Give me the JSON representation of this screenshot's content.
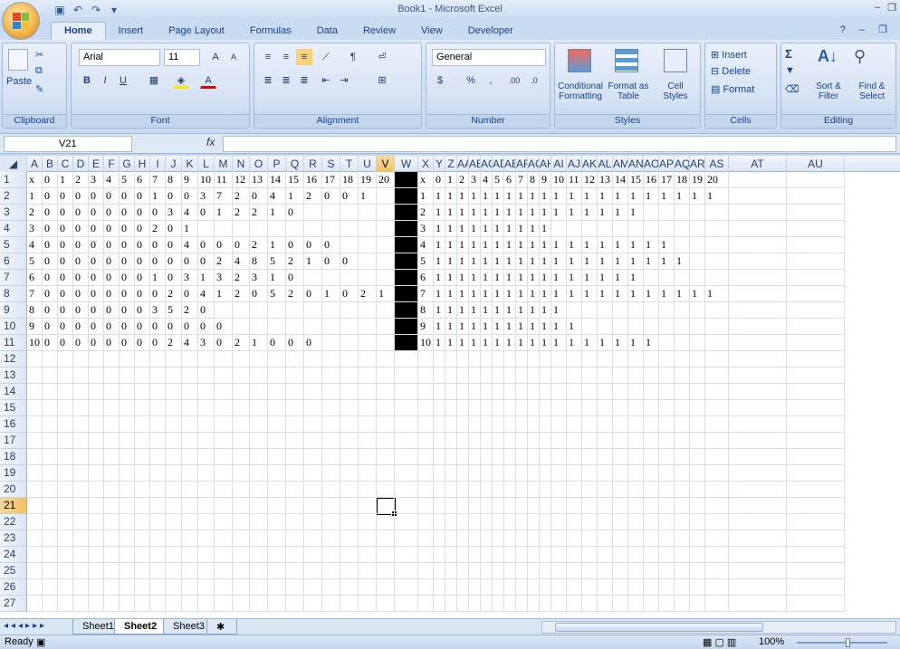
{
  "window": {
    "title": "Book1 - Microsoft Excel"
  },
  "tabs": [
    "Home",
    "Insert",
    "Page Layout",
    "Formulas",
    "Data",
    "Review",
    "View",
    "Developer"
  ],
  "ribbon": {
    "clipboard": {
      "paste": "Paste",
      "name": "Clipboard"
    },
    "font": {
      "family": "Arial",
      "size": "11",
      "name": "Font",
      "bold": "B",
      "italic": "I",
      "underline": "U"
    },
    "alignment": {
      "name": "Alignment"
    },
    "number": {
      "format": "General",
      "percent": "%",
      "comma": ",",
      "inc": ".00",
      "name": "Number"
    },
    "styles": {
      "cond": "Conditional Formatting",
      "table": "Format as Table",
      "cell": "Cell Styles",
      "name": "Styles"
    },
    "cells": {
      "insert": "Insert",
      "delete": "Delete",
      "format": "Format",
      "name": "Cells"
    },
    "editing": {
      "sigma": "Σ",
      "sort": "Sort & Filter",
      "find": "Find & Select",
      "name": "Editing"
    }
  },
  "formula_bar": {
    "name_box": "V21",
    "fx": "fx",
    "value": ""
  },
  "columns": [
    "A",
    "B",
    "C",
    "D",
    "E",
    "F",
    "G",
    "H",
    "I",
    "J",
    "K",
    "L",
    "M",
    "N",
    "O",
    "P",
    "Q",
    "R",
    "S",
    "T",
    "U",
    "V",
    "W",
    "X",
    "Y",
    "Z",
    "AA",
    "AB",
    "AC",
    "AD",
    "AE",
    "AF",
    "AG",
    "AH",
    "AI",
    "AJ",
    "AK",
    "AL",
    "AM",
    "AN",
    "AO",
    "AP",
    "AQ",
    "AR",
    "AS",
    "AT",
    "AU"
  ],
  "column_headers_shown": [
    "A",
    "B",
    "C",
    "D",
    "E",
    "F",
    "G",
    "H",
    "I",
    "J",
    "K",
    "L",
    "M",
    "N",
    "O",
    "P",
    "Q",
    "R",
    "S",
    "T",
    "U",
    "V",
    "W",
    "X",
    "Y",
    "Z",
    "AA",
    "AB",
    "AC",
    "AD",
    "AE",
    "AF",
    "AG",
    "AH",
    "AI",
    "AJ",
    "AK",
    "AL",
    "AM",
    "AN",
    "AO",
    "AP",
    "AQ",
    "AR",
    "AS",
    "AT",
    "AU"
  ],
  "rows": [
    [
      "x",
      "0",
      "1",
      "2",
      "3",
      "4",
      "5",
      "6",
      "7",
      "8",
      "9",
      "10",
      "11",
      "12",
      "13",
      "14",
      "15",
      "16",
      "17",
      "18",
      "19",
      "20",
      "",
      "x",
      "0",
      "1",
      "2",
      "3",
      "4",
      "5",
      "6",
      "7",
      "8",
      "9",
      "10",
      "11",
      "12",
      "13",
      "14",
      "15",
      "16",
      "17",
      "18",
      "19",
      "20"
    ],
    [
      "1",
      "0",
      "0",
      "0",
      "0",
      "0",
      "0",
      "0",
      "1",
      "0",
      "0",
      "3",
      "7",
      "2",
      "0",
      "4",
      "1",
      "2",
      "0",
      "0",
      "1",
      "",
      "",
      "1",
      "1",
      "1",
      "1",
      "1",
      "1",
      "1",
      "1",
      "1",
      "1",
      "1",
      "1",
      "1",
      "1",
      "1",
      "1",
      "1",
      "1",
      "1",
      "1",
      "1",
      "1"
    ],
    [
      "2",
      "0",
      "0",
      "0",
      "0",
      "0",
      "0",
      "0",
      "0",
      "3",
      "4",
      "0",
      "1",
      "2",
      "2",
      "1",
      "0",
      "",
      "",
      "",
      "",
      "",
      "",
      "2",
      "1",
      "1",
      "1",
      "1",
      "1",
      "1",
      "1",
      "1",
      "1",
      "1",
      "1",
      "1",
      "1",
      "1",
      "1",
      "1"
    ],
    [
      "3",
      "0",
      "0",
      "0",
      "0",
      "0",
      "0",
      "0",
      "2",
      "0",
      "1",
      "",
      "",
      "",
      "",
      "",
      "",
      "",
      "",
      "",
      "",
      "",
      "",
      "3",
      "1",
      "1",
      "1",
      "1",
      "1",
      "1",
      "1",
      "1",
      "1",
      "1"
    ],
    [
      "4",
      "0",
      "0",
      "0",
      "0",
      "0",
      "0",
      "0",
      "0",
      "0",
      "4",
      "0",
      "0",
      "0",
      "2",
      "1",
      "0",
      "0",
      "0",
      "",
      "",
      "",
      "",
      "4",
      "1",
      "1",
      "1",
      "1",
      "1",
      "1",
      "1",
      "1",
      "1",
      "1",
      "1",
      "1",
      "1",
      "1",
      "1",
      "1",
      "1",
      "1"
    ],
    [
      "5",
      "0",
      "0",
      "0",
      "0",
      "0",
      "0",
      "0",
      "0",
      "0",
      "0",
      "0",
      "2",
      "4",
      "8",
      "5",
      "2",
      "1",
      "0",
      "0",
      "",
      "",
      "",
      "5",
      "1",
      "1",
      "1",
      "1",
      "1",
      "1",
      "1",
      "1",
      "1",
      "1",
      "1",
      "1",
      "1",
      "1",
      "1",
      "1",
      "1",
      "1",
      "1"
    ],
    [
      "6",
      "0",
      "0",
      "0",
      "0",
      "0",
      "0",
      "0",
      "1",
      "0",
      "3",
      "1",
      "3",
      "2",
      "3",
      "1",
      "0",
      "",
      "",
      "",
      "",
      "",
      "",
      "6",
      "1",
      "1",
      "1",
      "1",
      "1",
      "1",
      "1",
      "1",
      "1",
      "1",
      "1",
      "1",
      "1",
      "1",
      "1",
      "1"
    ],
    [
      "7",
      "0",
      "0",
      "0",
      "0",
      "0",
      "0",
      "0",
      "0",
      "2",
      "0",
      "4",
      "1",
      "2",
      "0",
      "5",
      "2",
      "0",
      "1",
      "0",
      "2",
      "1",
      "",
      "7",
      "1",
      "1",
      "1",
      "1",
      "1",
      "1",
      "1",
      "1",
      "1",
      "1",
      "1",
      "1",
      "1",
      "1",
      "1",
      "1",
      "1",
      "1",
      "1",
      "1",
      "1"
    ],
    [
      "8",
      "0",
      "0",
      "0",
      "0",
      "0",
      "0",
      "0",
      "3",
      "5",
      "2",
      "0",
      "",
      "",
      "",
      "",
      "",
      "",
      "",
      "",
      "",
      "",
      "",
      "8",
      "1",
      "1",
      "1",
      "1",
      "1",
      "1",
      "1",
      "1",
      "1",
      "1",
      "1"
    ],
    [
      "9",
      "0",
      "0",
      "0",
      "0",
      "0",
      "0",
      "0",
      "0",
      "0",
      "0",
      "0",
      "0",
      "",
      "",
      "",
      "",
      "",
      "",
      "",
      "",
      "",
      "",
      "9",
      "1",
      "1",
      "1",
      "1",
      "1",
      "1",
      "1",
      "1",
      "1",
      "1",
      "1",
      "1"
    ],
    [
      "10",
      "0",
      "0",
      "0",
      "0",
      "0",
      "0",
      "0",
      "0",
      "2",
      "4",
      "3",
      "0",
      "2",
      "1",
      "0",
      "0",
      "0",
      "",
      "",
      "",
      "",
      "",
      "10",
      "1",
      "1",
      "1",
      "1",
      "1",
      "1",
      "1",
      "1",
      "1",
      "1",
      "1",
      "1",
      "1",
      "1",
      "1",
      "1",
      "1"
    ]
  ],
  "row_numbers": [
    "1",
    "2",
    "3",
    "4",
    "5",
    "6",
    "7",
    "8",
    "9",
    "10",
    "11",
    "12",
    "13",
    "14",
    "15",
    "16",
    "17",
    "18",
    "19",
    "20",
    "21",
    "22",
    "23",
    "24",
    "25",
    "26",
    "27"
  ],
  "sheets": [
    "Sheet1",
    "Sheet2",
    "Sheet3"
  ],
  "active_sheet": "Sheet2",
  "status": {
    "ready": "Ready",
    "zoom": "100%"
  }
}
